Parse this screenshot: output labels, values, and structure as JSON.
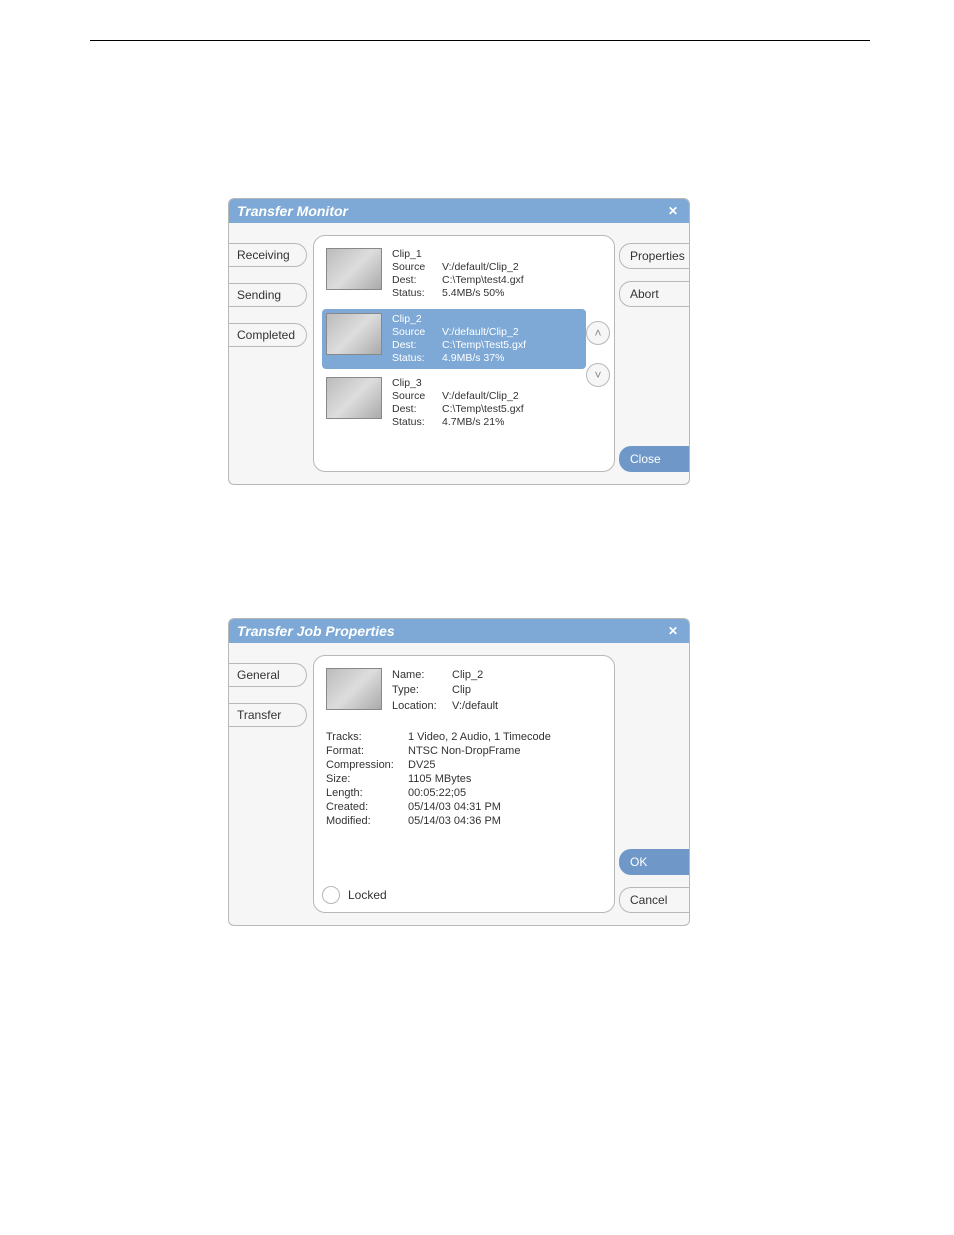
{
  "transfer_monitor": {
    "title": "Transfer Monitor",
    "tabs": {
      "receiving": "Receiving",
      "sending": "Sending",
      "completed": "Completed"
    },
    "buttons": {
      "properties": "Properties",
      "abort": "Abort",
      "close": "Close"
    },
    "clips": [
      {
        "name": "Clip_1",
        "labels": {
          "source": "Source",
          "dest": "Dest:",
          "status": "Status:"
        },
        "source": "V:/default/Clip_2",
        "dest": "C:\\Temp\\test4.gxf",
        "status": "5.4MB/s  50%"
      },
      {
        "name": "Clip_2",
        "labels": {
          "source": "Source",
          "dest": "Dest:",
          "status": "Status:"
        },
        "source": "V:/default/Clip_2",
        "dest": "C:\\Temp\\Test5.gxf",
        "status": "4.9MB/s  37%"
      },
      {
        "name": "Clip_3",
        "labels": {
          "source": "Source",
          "dest": "Dest:",
          "status": "Status:"
        },
        "source": "V:/default/Clip_2",
        "dest": "C:\\Temp\\test5.gxf",
        "status": "4.7MB/s  21%"
      }
    ]
  },
  "transfer_job_properties": {
    "title": "Transfer Job Properties",
    "tabs": {
      "general": "General",
      "transfer": "Transfer"
    },
    "header": {
      "labels": {
        "name": "Name:",
        "type": "Type:",
        "location": "Location:"
      },
      "name": "Clip_2",
      "type": "Clip",
      "location": "V:/default"
    },
    "props": {
      "labels": {
        "tracks": "Tracks:",
        "format": "Format:",
        "compression": "Compression:",
        "size": "Size:",
        "length": "Length:",
        "created": "Created:",
        "modified": "Modified:"
      },
      "tracks": "1 Video, 2 Audio, 1 Timecode",
      "format": "NTSC Non-DropFrame",
      "compression": "DV25",
      "size": "1105 MBytes",
      "length": "00:05:22;05",
      "created": "05/14/03 04:31 PM",
      "modified": "05/14/03 04:36 PM"
    },
    "locked_label": "Locked",
    "buttons": {
      "ok": "OK",
      "cancel": "Cancel"
    }
  }
}
